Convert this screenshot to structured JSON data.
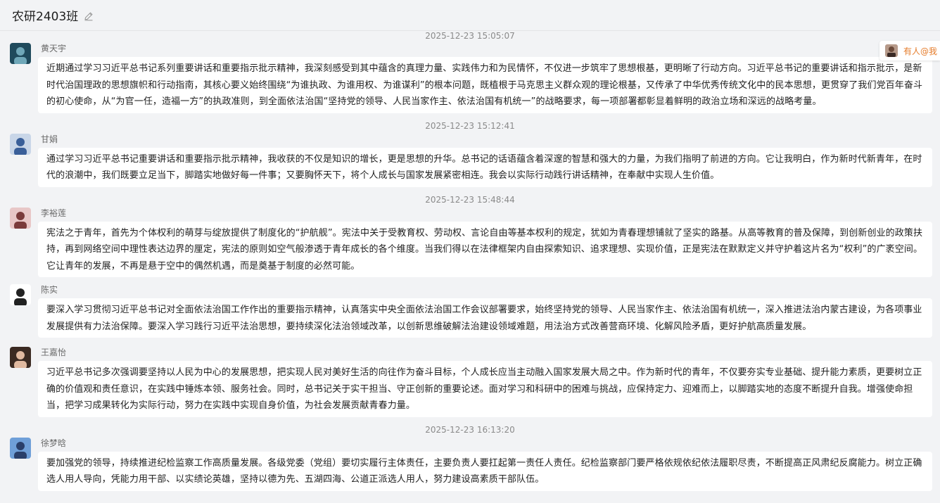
{
  "header": {
    "title": "农研2403班",
    "edit_icon": "pencil-icon"
  },
  "mention": {
    "label": "有人@我",
    "color": "#e57c2b"
  },
  "messages": [
    {
      "timestamp": "2025-12-23 15:05:07",
      "sender": "黄天宇",
      "avatar_colors": [
        "#1f4a5c",
        "#6fa7b8"
      ],
      "text": "近期通过学习习近平总书记系列重要讲话和重要指示批示精神，我深刻感受到其中蕴含的真理力量、实践伟力和为民情怀，不仅进一步筑牢了思想根基，更明晰了行动方向。习近平总书记的重要讲话和指示批示，是新时代治国理政的思想旗帜和行动指南，其核心要义始终围绕“为谁执政、为谁用权、为谁谋利”的根本问题，既植根于马克思主义群众观的理论根基，又传承了中华优秀传统文化中的民本思想，更贯穿了我们党百年奋斗的初心使命，从“为官一任，造福一方”的执政准则，到全面依法治国“坚持党的领导、人民当家作主、依法治国有机统一”的战略要求，每一项部署都彰显着鲜明的政治立场和深远的战略考量。"
    },
    {
      "timestamp": "2025-12-23 15:12:41",
      "sender": "甘娟",
      "avatar_colors": [
        "#c9d6e8",
        "#3a5f99"
      ],
      "text": "通过学习习近平总书记重要讲话和重要指示批示精神，我收获的不仅是知识的增长，更是思想的升华。总书记的话语蕴含着深邃的智慧和强大的力量，为我们指明了前进的方向。它让我明白，作为新时代新青年，在时代的浪潮中，我们既要立足当下，脚踏实地做好每一件事；又要胸怀天下，将个人成长与国家发展紧密相连。我会以实际行动践行讲话精神，在奉献中实现人生价值。"
    },
    {
      "timestamp": "2025-12-23 15:48:44",
      "sender": "李裕莲",
      "avatar_colors": [
        "#e8c7c7",
        "#7a3b3b"
      ],
      "text": "宪法之于青年，首先为个体权利的萌芽与绽放提供了制度化的“护航舰”。宪法中关于受教育权、劳动权、言论自由等基本权利的规定，犹如为青春理想铺就了坚实的路基。从高等教育的普及保障，到创新创业的政策扶持，再到网络空间中理性表达边界的厘定，宪法的原则如空气般渗透于青年成长的各个维度。当我们得以在法律框架内自由探索知识、追求理想、实现价值，正是宪法在默默定义并守护着这片名为“权利”的广袤空间。它让青年的发展，不再是悬于空中的偶然机遇，而是奠基于制度的必然可能。"
    },
    {
      "timestamp": "",
      "sender": "陈实",
      "avatar_colors": [
        "#ffffff",
        "#222222"
      ],
      "text": "要深入学习贯彻习近平总书记对全面依法治国工作作出的重要指示精神，认真落实中央全面依法治国工作会议部署要求，始终坚持党的领导、人民当家作主、依法治国有机统一，深入推进法治内蒙古建设，为各项事业发展提供有力法治保障。要深入学习践行习近平法治思想，要持续深化法治领域改革，以创新思维破解法治建设领域难题，用法治方式改善营商环境、化解风险矛盾，更好护航高质量发展。"
    },
    {
      "timestamp": "",
      "sender": "王嘉怡",
      "avatar_colors": [
        "#3b2a22",
        "#e0b9a0"
      ],
      "text": "习近平总书记多次强调要坚持以人民为中心的发展思想，把实现人民对美好生活的向往作为奋斗目标，个人成长应当主动融入国家发展大局之中。作为新时代的青年，不仅要夯实专业基础、提升能力素质，更要树立正确的价值观和责任意识，在实践中锤炼本领、服务社会。同时，总书记关于实干担当、守正创新的重要论述。面对学习和科研中的困难与挑战，应保持定力、迎难而上，以脚踏实地的态度不断提升自我。增强使命担当，把学习成果转化为实际行动，努力在实践中实现自身价值，为社会发展贡献青春力量。"
    },
    {
      "timestamp": "2025-12-23 16:13:20",
      "sender": "徐梦晗",
      "avatar_colors": [
        "#6f9fd8",
        "#2a3f6a"
      ],
      "text": "要加强党的领导，持续推进纪检监察工作高质量发展。各级党委（党组）要切实履行主体责任，主要负责人要扛起第一责任人责任。纪检监察部门要严格依规依纪依法履职尽责，不断提高正风肃纪反腐能力。树立正确选人用人导向，凭能力用干部、以实绩论英雄，坚持以德为先、五湖四海、公道正派选人用人，努力建设高素质干部队伍。"
    }
  ]
}
